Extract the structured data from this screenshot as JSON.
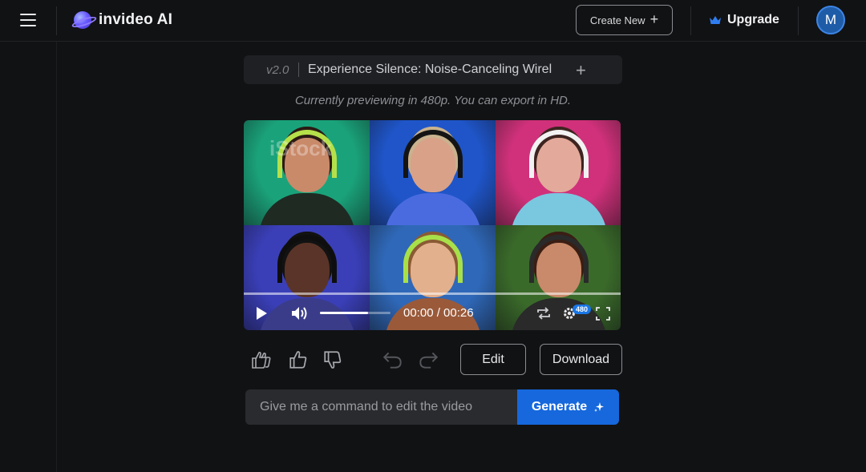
{
  "header": {
    "app_name": "invideo AI",
    "create_new_label": "Create New",
    "upgrade_label": "Upgrade",
    "avatar_initial": "M",
    "accent": "#1668dc"
  },
  "editor": {
    "version": "v2.0",
    "video_title": "Experience Silence: Noise-Canceling Wirel",
    "preview_note": "Currently previewing in 480p. You can export in HD."
  },
  "player": {
    "watermark": "iStock",
    "time_display": "00:00 / 00:26",
    "quality_badge": "480",
    "progress_fraction": 0.0,
    "volume_fraction": 0.68,
    "tiles": [
      {
        "bg": "#1aa37a",
        "skin": "#c98a6a",
        "hair": "#2b1a14",
        "shirt": "#1f2a22",
        "phones": "#b6e04a"
      },
      {
        "bg": "#1f55c8",
        "skin": "#d9a187",
        "hair": "#c9b28e",
        "shirt": "#4a6be0",
        "phones": "#141414"
      },
      {
        "bg": "#d0317a",
        "skin": "#e3a99a",
        "hair": "#3d2420",
        "shirt": "#7ac7e0",
        "phones": "#f2f2f2"
      },
      {
        "bg": "#3a3fb8",
        "skin": "#5a3428",
        "hair": "#121212",
        "shirt": "#3a3c8a",
        "phones": "#0e0e0e"
      },
      {
        "bg": "#2f68b8",
        "skin": "#e2b08c",
        "hair": "#8a5a34",
        "shirt": "#9a5a3a",
        "phones": "#a8e04a"
      },
      {
        "bg": "#3a6a2a",
        "skin": "#c88a6a",
        "hair": "#3a1e14",
        "shirt": "#2a2a2a",
        "phones": "#2a2a2a"
      }
    ]
  },
  "actions": {
    "edit_label": "Edit",
    "download_label": "Download"
  },
  "command": {
    "placeholder": "Give me a command to edit the video",
    "value": "",
    "generate_label": "Generate"
  }
}
